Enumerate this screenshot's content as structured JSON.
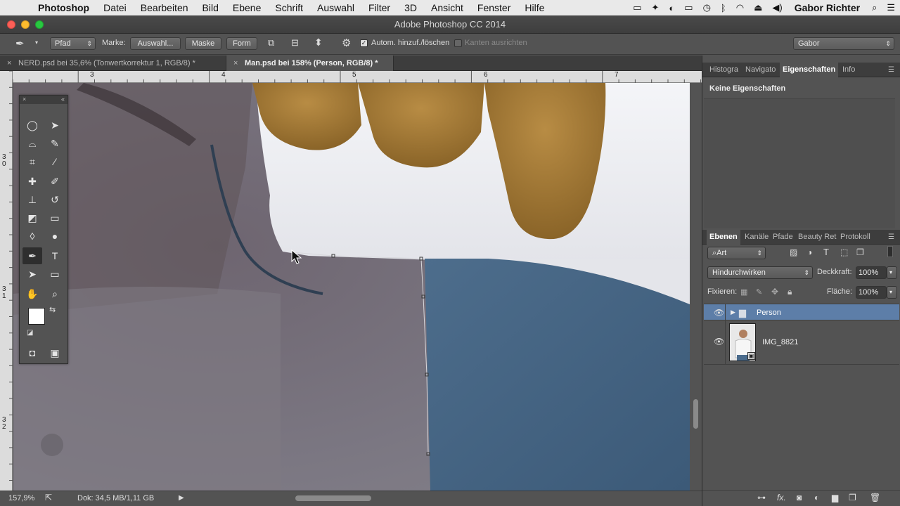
{
  "menubar": {
    "app": "Photoshop",
    "items": [
      "Datei",
      "Bearbeiten",
      "Bild",
      "Ebene",
      "Schrift",
      "Auswahl",
      "Filter",
      "3D",
      "Ansicht",
      "Fenster",
      "Hilfe"
    ],
    "user": "Gabor Richter"
  },
  "window": {
    "title": "Adobe Photoshop CC 2014"
  },
  "options": {
    "mode": "Pfad",
    "marke_label": "Marke:",
    "auswahl": "Auswahl...",
    "maske": "Maske",
    "form": "Form",
    "auto_label": "Autom. hinzuf./löschen",
    "auto_checked": true,
    "kanten_label": "Kanten ausrichten",
    "workspace": "Gabor"
  },
  "tabs": [
    {
      "label": "NERD.psd bei 35,6% (Tonwertkorrektur 1, RGB/8) *",
      "active": false
    },
    {
      "label": "Man.psd bei 158% (Person, RGB/8) *",
      "active": true
    }
  ],
  "rulers": {
    "h": [
      "3",
      "4",
      "5",
      "6",
      "7"
    ],
    "v": [
      "3\n0",
      "3\n1",
      "3\n2"
    ]
  },
  "status": {
    "zoom": "157,9%",
    "doc": "Dok: 34,5 MB/1,11 GB"
  },
  "props_panel": {
    "tabs": [
      "Histogra",
      "Navigato",
      "Eigenschaften",
      "Info"
    ],
    "active": "Eigenschaften",
    "content": "Keine Eigenschaften"
  },
  "layers_panel": {
    "tabs": [
      "Ebenen",
      "Kanäle",
      "Pfade",
      "Beauty Ret",
      "Protokoll"
    ],
    "active": "Ebenen",
    "filter": "Art",
    "blend": "Hindurchwirken",
    "opacity_label": "Deckkraft:",
    "opacity": "100%",
    "lock_label": "Fixieren:",
    "fill_label": "Fläche:",
    "fill": "100%",
    "layers": [
      {
        "name": "Person",
        "type": "group",
        "selected": true
      },
      {
        "name": "IMG_8821",
        "type": "smart",
        "selected": false
      }
    ]
  },
  "colors": {
    "accent": "#5d7ea8",
    "panel": "#535353",
    "dark": "#3d3d3d"
  }
}
